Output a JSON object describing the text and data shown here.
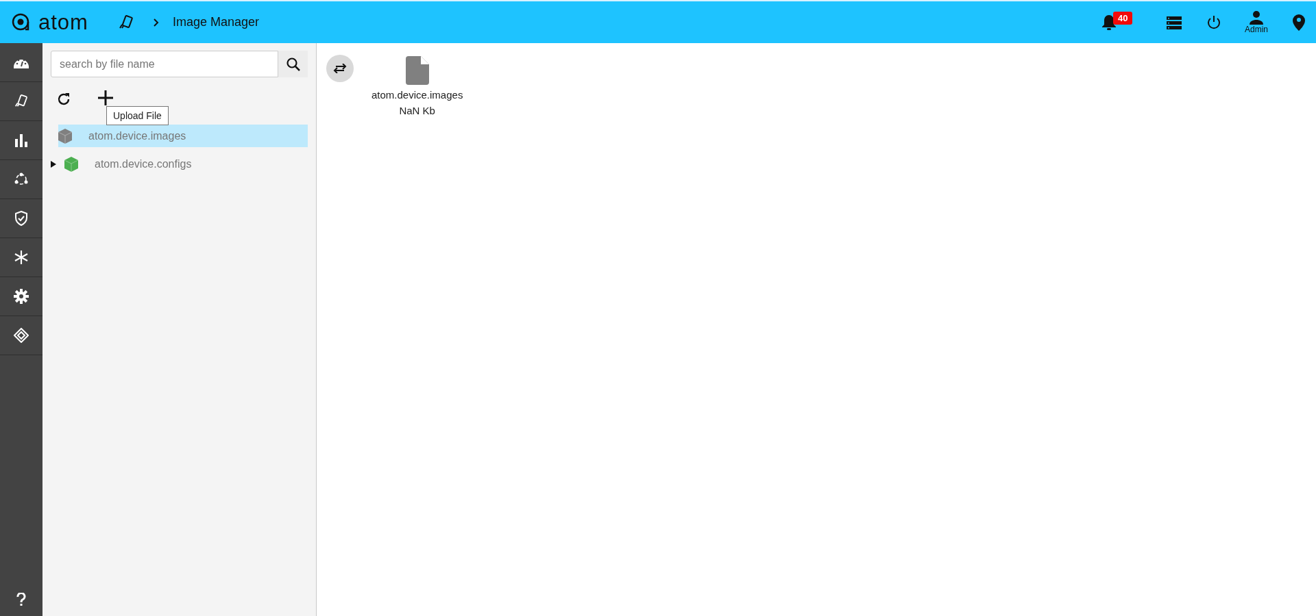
{
  "header": {
    "logo": "atom",
    "breadcrumb": "Image Manager",
    "notification_count": "40",
    "user": "Admin"
  },
  "search": {
    "placeholder": "search by file name"
  },
  "tooltip": "Upload File",
  "tree": [
    {
      "label": "atom.device.images",
      "selected": true,
      "color": "#808080",
      "expandable": false
    },
    {
      "label": "atom.device.configs",
      "selected": false,
      "color": "#4caf50",
      "expandable": true
    }
  ],
  "files": [
    {
      "name": "atom.device.images",
      "size": "NaN Kb"
    }
  ]
}
